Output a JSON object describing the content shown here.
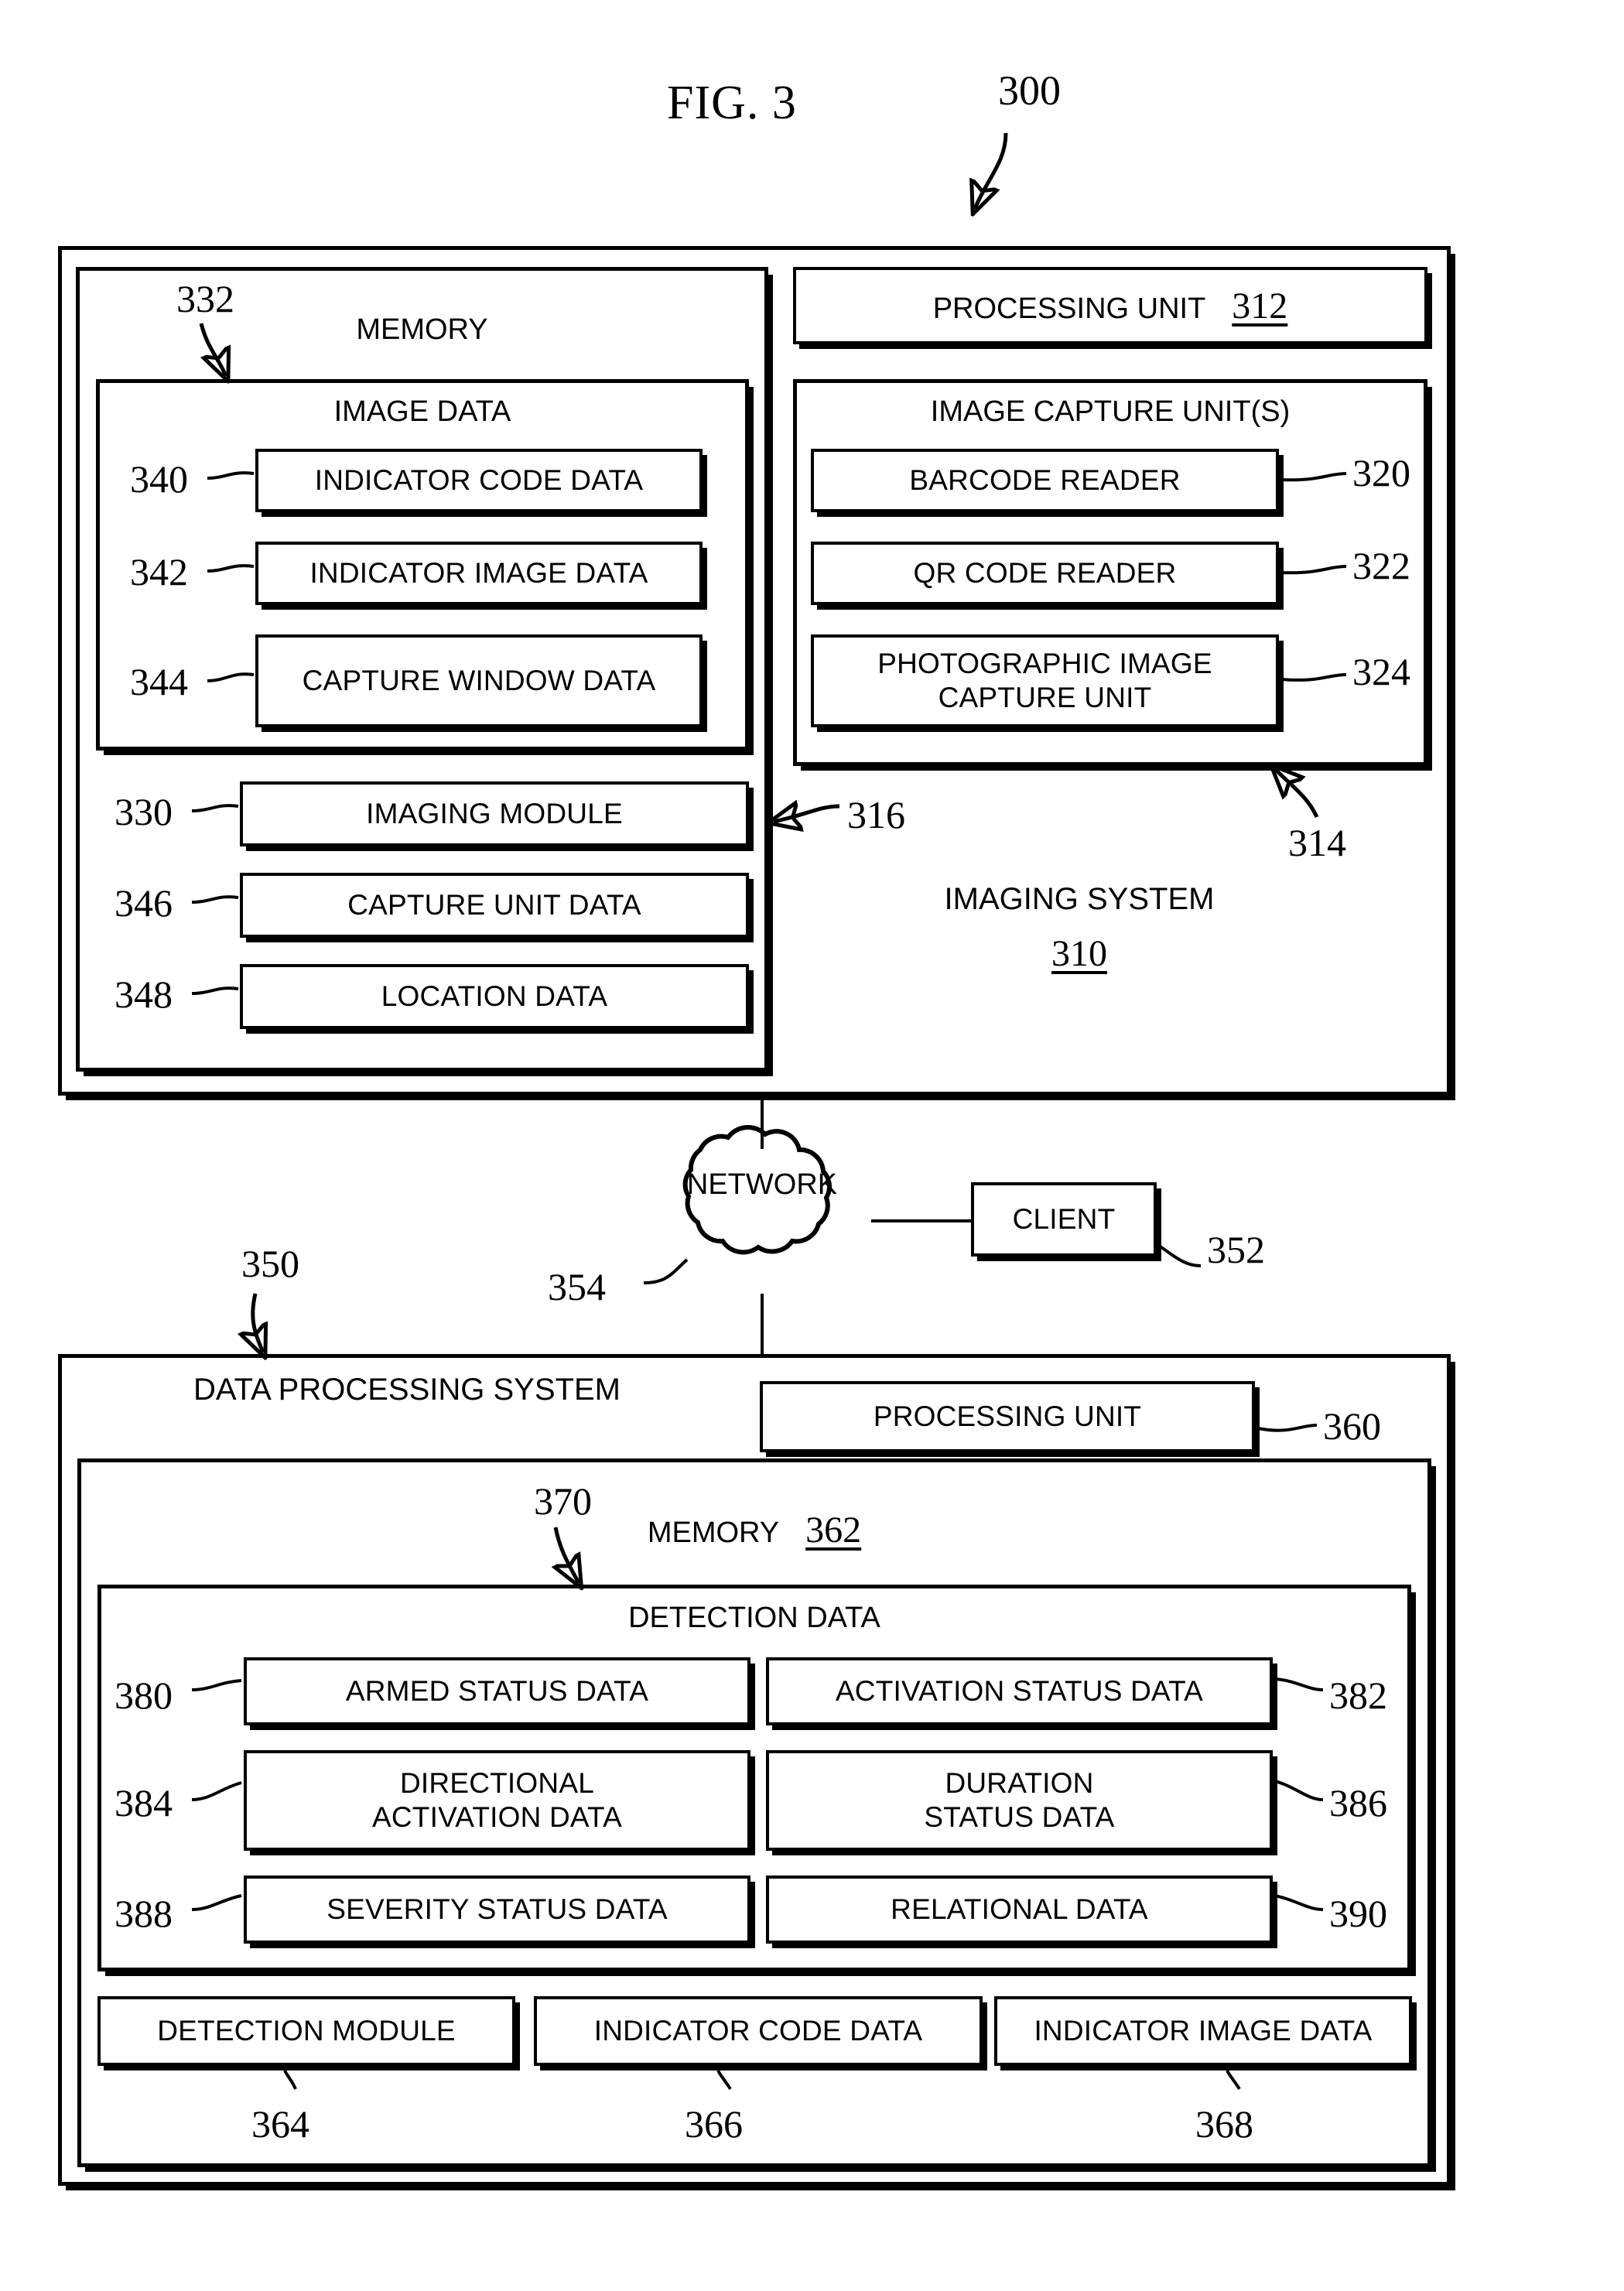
{
  "figure": {
    "title": "FIG. 3",
    "system_ref": "300"
  },
  "imaging_system": {
    "title": "IMAGING SYSTEM",
    "ref": "310",
    "ref_bus": "316",
    "ref_capture_group": "314",
    "memory": {
      "title": "MEMORY",
      "ref": "332",
      "image_data": {
        "title": "IMAGE DATA",
        "items": [
          {
            "label": "INDICATOR CODE DATA",
            "ref": "340"
          },
          {
            "label": "INDICATOR IMAGE DATA",
            "ref": "342"
          },
          {
            "label": "CAPTURE WINDOW DATA",
            "ref": "344"
          }
        ]
      },
      "modules": [
        {
          "label": "IMAGING MODULE",
          "ref": "330"
        },
        {
          "label": "CAPTURE UNIT DATA",
          "ref": "346"
        },
        {
          "label": "LOCATION DATA",
          "ref": "348"
        }
      ]
    },
    "processing_unit": {
      "label": "PROCESSING UNIT",
      "ref": "312"
    },
    "image_capture_units": {
      "title": "IMAGE CAPTURE UNIT(S)",
      "items": [
        {
          "label": "BARCODE READER",
          "ref": "320"
        },
        {
          "label": "QR CODE READER",
          "ref": "322"
        },
        {
          "label": "PHOTOGRAPHIC IMAGE\nCAPTURE UNIT",
          "ref": "324"
        }
      ]
    }
  },
  "network": {
    "label": "NETWORK",
    "ref": "354"
  },
  "client": {
    "label": "CLIENT",
    "ref": "352"
  },
  "data_processing_system": {
    "title": "DATA PROCESSING\nSYSTEM",
    "ref": "350",
    "processing_unit": {
      "label": "PROCESSING UNIT",
      "ref": "360"
    },
    "memory": {
      "title": "MEMORY",
      "ref": "362"
    },
    "detection_data": {
      "title": "DETECTION DATA",
      "ref": "370",
      "items": [
        {
          "label": "ARMED STATUS DATA",
          "ref": "380"
        },
        {
          "label": "ACTIVATION STATUS DATA",
          "ref": "382"
        },
        {
          "label": "DIRECTIONAL\nACTIVATION DATA",
          "ref": "384"
        },
        {
          "label": "DURATION\nSTATUS DATA",
          "ref": "386"
        },
        {
          "label": "SEVERITY STATUS DATA",
          "ref": "388"
        },
        {
          "label": "RELATIONAL DATA",
          "ref": "390"
        }
      ]
    },
    "modules": [
      {
        "label": "DETECTION MODULE",
        "ref": "364"
      },
      {
        "label": "INDICATOR CODE DATA",
        "ref": "366"
      },
      {
        "label": "INDICATOR IMAGE DATA",
        "ref": "368"
      }
    ]
  }
}
